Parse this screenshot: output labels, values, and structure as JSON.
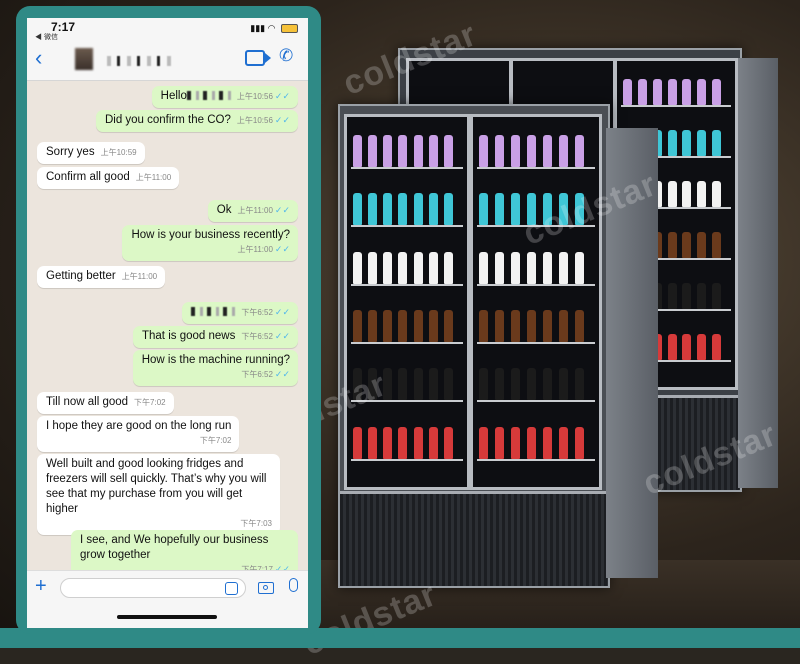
{
  "status": {
    "time": "7:17",
    "back_app": "◀ 微信"
  },
  "watermark": "coldstar",
  "colors": {
    "outgoing": "#dcf8c6",
    "incoming": "#ffffff",
    "accent": "#1f6fd1",
    "frame": "#2f8a86"
  },
  "messages": [
    {
      "dir": "out",
      "text": "Hello",
      "blurred": true,
      "time": "上午10:56",
      "ticks": "✓✓"
    },
    {
      "dir": "out",
      "text": "Did you  confirm the CO?",
      "time": "上午10:56",
      "ticks": "✓✓"
    },
    {
      "dir": "in",
      "text": "Sorry yes",
      "time": "上午10:59"
    },
    {
      "dir": "in",
      "text": "Confirm all good",
      "time": "上午11:00"
    },
    {
      "dir": "out",
      "text": "Ok",
      "time": "上午11:00",
      "ticks": "✓✓"
    },
    {
      "dir": "out",
      "text": "How is your business recently?",
      "time": "上午11:00",
      "ticks": "✓✓"
    },
    {
      "dir": "in",
      "text": "Getting better",
      "time": "上午11:00"
    },
    {
      "dir": "out",
      "text": "",
      "blurred": true,
      "time": "下午6:52",
      "ticks": "✓✓"
    },
    {
      "dir": "out",
      "text": "That is good news",
      "time": "下午6:52",
      "ticks": "✓✓"
    },
    {
      "dir": "out",
      "text": "How is the machine running?",
      "time": "下午6:52",
      "ticks": "✓✓"
    },
    {
      "dir": "in",
      "text": "Till now all good",
      "time": "下午7:02"
    },
    {
      "dir": "in",
      "text": "I hope they are good on the long run",
      "time": "下午7:02"
    },
    {
      "dir": "in",
      "text": "Well built and good looking fridges and freezers will sell quickly. That’s why you will see that my purchase from you will get higher",
      "time": "下午7:03"
    },
    {
      "dir": "out",
      "text": "I see, and We hopefully our business grow together",
      "time": "下午7:17",
      "ticks": "✓✓"
    }
  ]
}
